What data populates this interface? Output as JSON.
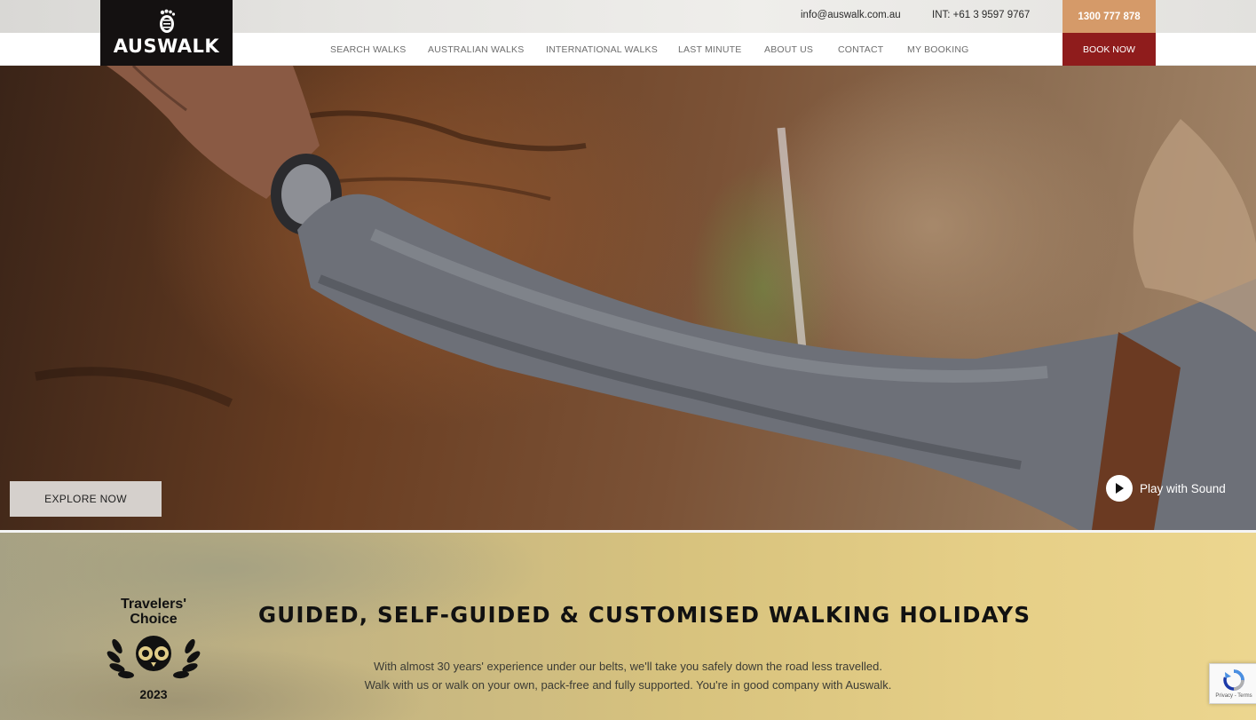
{
  "header": {
    "logo_text": "AUSWALK",
    "email": "info@auswalk.com.au",
    "international_phone": "INT: +61 3 9597 9767",
    "phone": "1300 777 878",
    "book_now": "BOOK NOW",
    "nav": [
      {
        "label": "SEARCH WALKS"
      },
      {
        "label": "AUSTRALIAN WALKS"
      },
      {
        "label": "INTERNATIONAL WALKS"
      },
      {
        "label": "LAST MINUTE"
      },
      {
        "label": "ABOUT US"
      },
      {
        "label": "CONTACT"
      },
      {
        "label": "MY BOOKING"
      }
    ]
  },
  "hero": {
    "explore_button": "EXPLORE NOW",
    "play_label": "Play with Sound",
    "play_icon": "play-icon"
  },
  "intro": {
    "badge": {
      "line1": "Travelers'",
      "line2": "Choice",
      "year": "2023",
      "icon": "tripadvisor-owl-icon"
    },
    "headline": "GUIDED, SELF-GUIDED & CUSTOMISED WALKING HOLIDAYS",
    "text_line1": "With almost 30 years' experience under our belts, we'll take you safely down the road less travelled.",
    "text_line2": "Walk with us or walk on your own, pack-free and fully supported. You're in good company with Auswalk."
  },
  "recaptcha": {
    "text": "Privacy - Terms",
    "icon": "recaptcha-icon"
  },
  "colors": {
    "phone_bg": "#d59a69",
    "book_bg": "#8f1c1c",
    "logo_bg": "#141111"
  }
}
